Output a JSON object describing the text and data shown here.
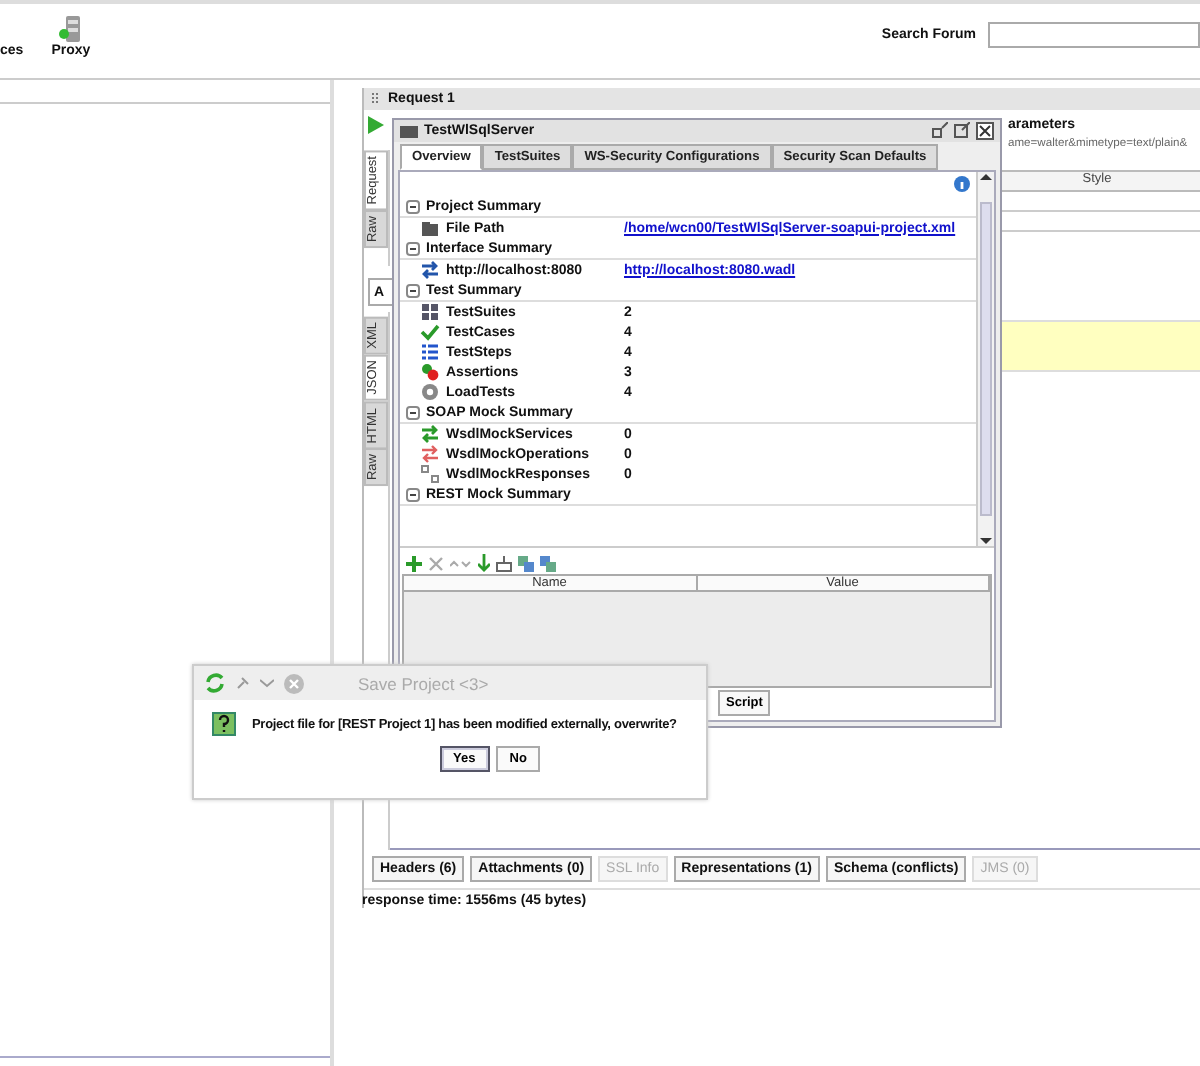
{
  "toolbar": {
    "items": [
      {
        "label": "ces"
      },
      {
        "label": "Proxy"
      }
    ],
    "search_label": "Search Forum"
  },
  "request_window": {
    "title": "Request 1",
    "params_heading": "arameters",
    "params_value": "ame=walter&mimetype=text/plain&",
    "column_header": "Style",
    "field_fragment": "A",
    "side_tabs": [
      {
        "label": "Request",
        "selected": true
      },
      {
        "label": "Raw",
        "selected": false
      }
    ],
    "response_tabs": [
      {
        "label": "XML",
        "selected": false
      },
      {
        "label": "JSON",
        "selected": true
      },
      {
        "label": "HTML",
        "selected": false
      },
      {
        "label": "Raw",
        "selected": false
      }
    ],
    "bottom_tabs": [
      {
        "label": "Headers (6)",
        "disabled": false
      },
      {
        "label": "Attachments (0)",
        "disabled": false
      },
      {
        "label": "SSL Info",
        "disabled": true
      },
      {
        "label": "Representations (1)",
        "disabled": false
      },
      {
        "label": "Schema (conflicts)",
        "disabled": false
      },
      {
        "label": "JMS (0)",
        "disabled": true
      }
    ],
    "status": "response time: 1556ms (45 bytes)"
  },
  "project_window": {
    "title": "TestWlSqlServer",
    "tabs": [
      {
        "label": "Overview",
        "selected": true
      },
      {
        "label": "TestSuites",
        "selected": false
      },
      {
        "label": "WS-Security Configurations",
        "selected": false
      },
      {
        "label": "Security Scan Defaults",
        "selected": false
      }
    ],
    "sections": [
      {
        "title": "Project Summary",
        "expanded": true,
        "rows": [
          {
            "label": "File Path",
            "value": "/home/wcn00/TestWlSqlServer-soapui-project.xml",
            "kind": "link"
          }
        ]
      },
      {
        "title": "Interface Summary",
        "expanded": true,
        "rows": [
          {
            "label": "http://localhost:8080",
            "value": "http://localhost:8080.wadl",
            "kind": "link"
          }
        ]
      },
      {
        "title": "Test Summary",
        "expanded": true,
        "rows": [
          {
            "label": "TestSuites",
            "value": "2",
            "kind": "count"
          },
          {
            "label": "TestCases",
            "value": "4",
            "kind": "count"
          },
          {
            "label": "TestSteps",
            "value": "4",
            "kind": "count"
          },
          {
            "label": "Assertions",
            "value": "3",
            "kind": "count"
          },
          {
            "label": "LoadTests",
            "value": "4",
            "kind": "count"
          }
        ]
      },
      {
        "title": "SOAP Mock Summary",
        "expanded": true,
        "rows": [
          {
            "label": "WsdlMockServices",
            "value": "0",
            "kind": "count"
          },
          {
            "label": "WsdlMockOperations",
            "value": "0",
            "kind": "count"
          },
          {
            "label": "WsdlMockResponses",
            "value": "0",
            "kind": "count"
          }
        ]
      },
      {
        "title": "REST Mock Summary",
        "expanded": true
      }
    ],
    "table": {
      "columns": [
        "Name",
        "Value"
      ]
    },
    "button": "Script"
  },
  "dialog": {
    "title": "Save Project <3>",
    "message": "Project file for [REST Project 1] has been modified externally, overwrite?",
    "buttons": [
      {
        "label": "Yes",
        "selected": true
      },
      {
        "label": "No",
        "selected": false
      }
    ]
  }
}
